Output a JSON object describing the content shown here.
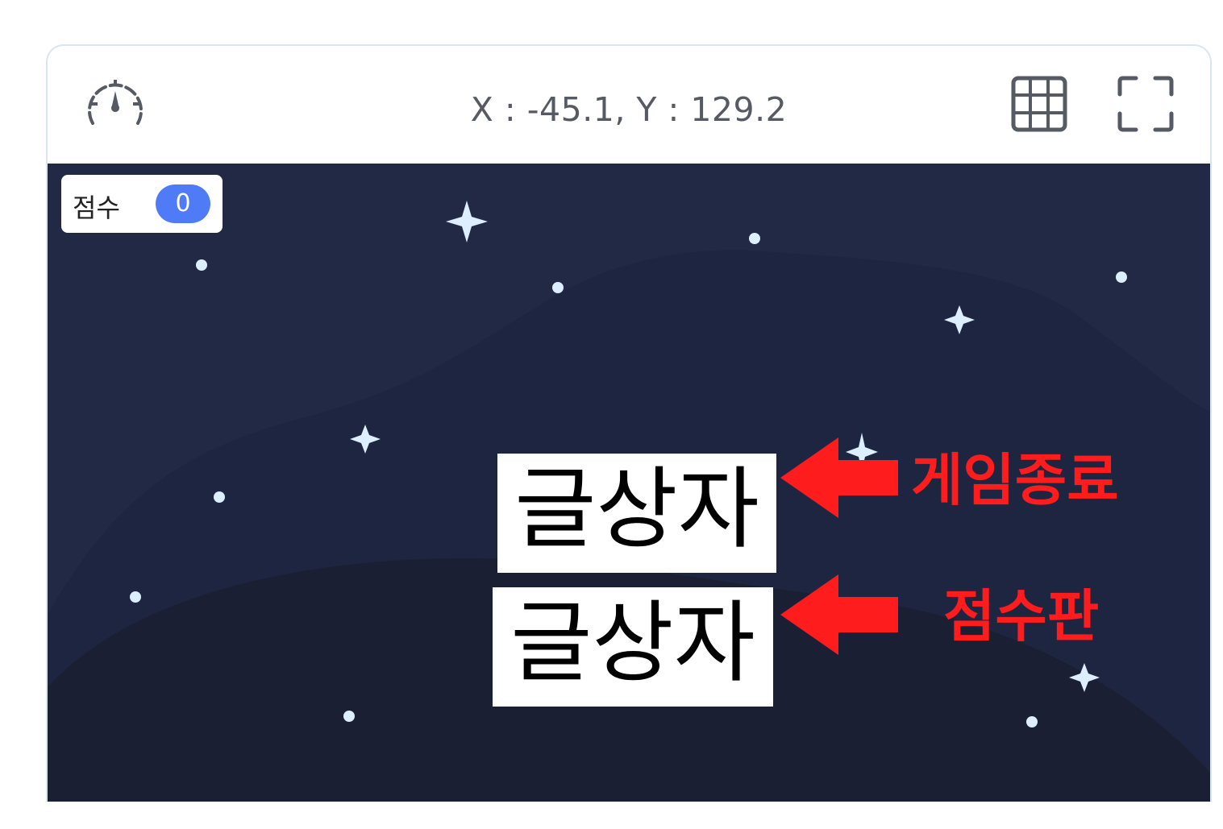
{
  "toolbar": {
    "coordinates": "X : -45.1, Y : 129.2",
    "icons": [
      "speed-gauge-icon",
      "grid-icon",
      "fullscreen-icon"
    ]
  },
  "stage": {
    "score_monitor": {
      "label": "점수",
      "value": "0"
    },
    "text_sprites": [
      {
        "text": "글상자"
      },
      {
        "text": "글상자"
      }
    ]
  },
  "annotations": [
    {
      "label": "게임종료",
      "color": "#ff1c1c"
    },
    {
      "label": "점수판",
      "color": "#ff1c1c"
    }
  ],
  "colors": {
    "stage_background": "#1b2034",
    "hill_light": "#212945",
    "hill_mid": "#1e2540",
    "star": "#dceeff",
    "score_badge": "#4f7cf6",
    "annotation": "#ff1c1c"
  }
}
